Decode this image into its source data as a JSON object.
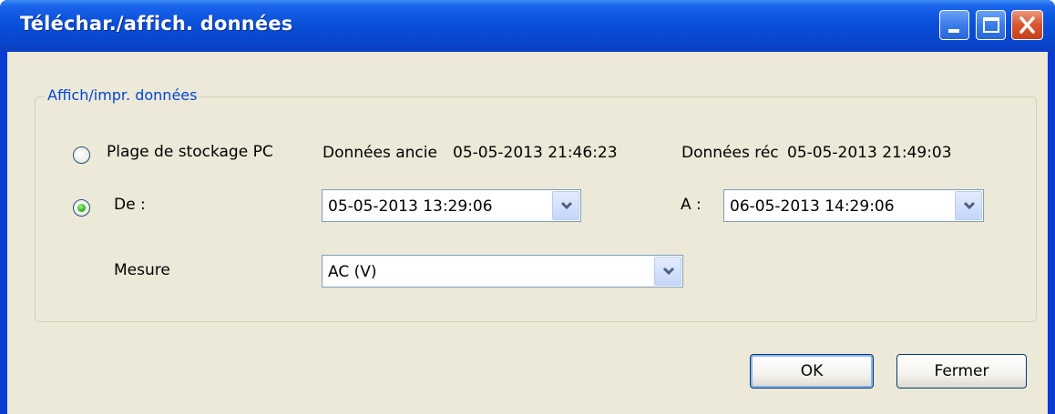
{
  "window": {
    "title": "Téléchar./affich. données"
  },
  "group": {
    "legend": "Affich/impr. données",
    "pc_range": {
      "label": "Plage de stockage PC",
      "selected": false,
      "oldest_label": "Données ancie",
      "oldest_value": "05-05-2013 21:46:23",
      "newest_label": "Données réc",
      "newest_value": "05-05-2013 21:49:03"
    },
    "range": {
      "from_label": "De :",
      "selected": true,
      "from_value": "05-05-2013 13:29:06",
      "to_label": "A :",
      "to_value": "06-05-2013 14:29:06"
    },
    "measure": {
      "label": "Mesure",
      "value": "AC (V)"
    }
  },
  "buttons": {
    "ok": "OK",
    "close": "Fermer"
  },
  "icons": {
    "minimize": "minimize-icon",
    "maximize": "maximize-icon",
    "close": "close-icon",
    "dropdown": "chevron-down-icon"
  }
}
